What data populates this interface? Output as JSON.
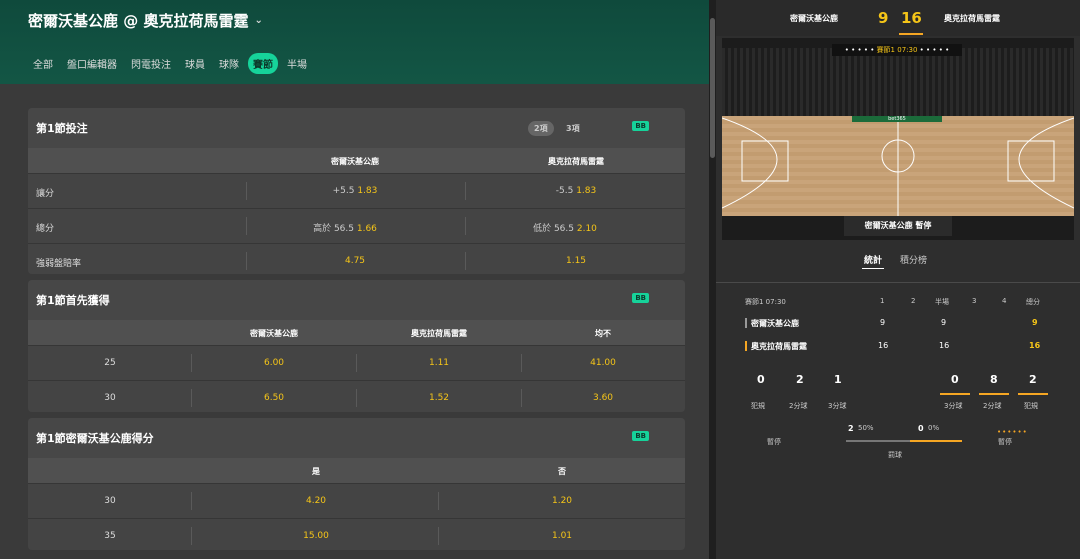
{
  "header": {
    "title": "密爾沃基公鹿 @ 奧克拉荷馬雷霆"
  },
  "tabs": [
    {
      "label": "全部"
    },
    {
      "label": "盤口編輯器"
    },
    {
      "label": "閃電投注"
    },
    {
      "label": "球員"
    },
    {
      "label": "球隊"
    },
    {
      "label": "賽節",
      "active": true
    },
    {
      "label": "半場"
    }
  ],
  "market1": {
    "title": "第1節投注",
    "pill1": "2項",
    "pill2": "3項",
    "badge": "BB",
    "col_a": "密爾沃基公鹿",
    "col_b": "奧克拉荷馬雷霆",
    "rows": [
      {
        "label": "讓分",
        "a_line": "+5.5",
        "a_odds": "1.83",
        "b_line": "-5.5",
        "b_odds": "1.83"
      },
      {
        "label": "總分",
        "a_line": "高於 56.5",
        "a_odds": "1.66",
        "b_line": "低於 56.5",
        "b_odds": "2.10"
      },
      {
        "label": "強弱盤賠率",
        "a_line": "",
        "a_odds": "4.75",
        "b_line": "",
        "b_odds": "1.15"
      }
    ]
  },
  "market2": {
    "title": "第1節首先獲得",
    "badge": "BB",
    "col_a": "密爾沃基公鹿",
    "col_b": "奧克拉荷馬雷霆",
    "col_c": "均不",
    "rows": [
      {
        "label": "25",
        "a": "6.00",
        "b": "1.11",
        "c": "41.00"
      },
      {
        "label": "30",
        "a": "6.50",
        "b": "1.52",
        "c": "3.60"
      }
    ]
  },
  "market3": {
    "title": "第1節密爾沃基公鹿得分",
    "badge": "BB",
    "col_a": "是",
    "col_b": "否",
    "rows": [
      {
        "label": "30",
        "a": "4.20",
        "b": "1.20"
      },
      {
        "label": "35",
        "a": "15.00",
        "b": "1.01"
      }
    ]
  },
  "scoreboard": {
    "home": "密爾沃基公鹿",
    "home_score": "9",
    "away_score": "16",
    "away": "奧克拉荷馬雷霆"
  },
  "court": {
    "clock": "賽節1 07:30",
    "sponsor": "bet365",
    "status": "密爾沃基公鹿 暫停"
  },
  "stat_tabs": {
    "stats": "統計",
    "standings": "積分榜"
  },
  "table": {
    "period": "賽節1 07:30",
    "cols": [
      "1",
      "2",
      "半場",
      "3",
      "4",
      "總分"
    ],
    "teams": [
      {
        "name": "密爾沃基公鹿",
        "q1": "9",
        "half": "9",
        "total": "9",
        "color": "#999999"
      },
      {
        "name": "奧克拉荷馬雷霆",
        "q1": "16",
        "half": "16",
        "total": "16",
        "color": "#f5a623"
      }
    ]
  },
  "home_stats": {
    "fouls": "0",
    "two": "2",
    "three": "1"
  },
  "away_stats": {
    "three": "0",
    "two": "8",
    "fouls": "2"
  },
  "stat_labels": {
    "fouls": "犯規",
    "two": "2分球",
    "three": "3分球"
  },
  "timeouts": {
    "label": "暫停"
  },
  "possession": {
    "home_val": "2",
    "home_pct": "50%",
    "away_val": "0",
    "away_pct": "0%",
    "label": "罰球"
  },
  "colors": {
    "accent": "#16d39a",
    "odds": "#f5c518",
    "away": "#f5a623"
  }
}
